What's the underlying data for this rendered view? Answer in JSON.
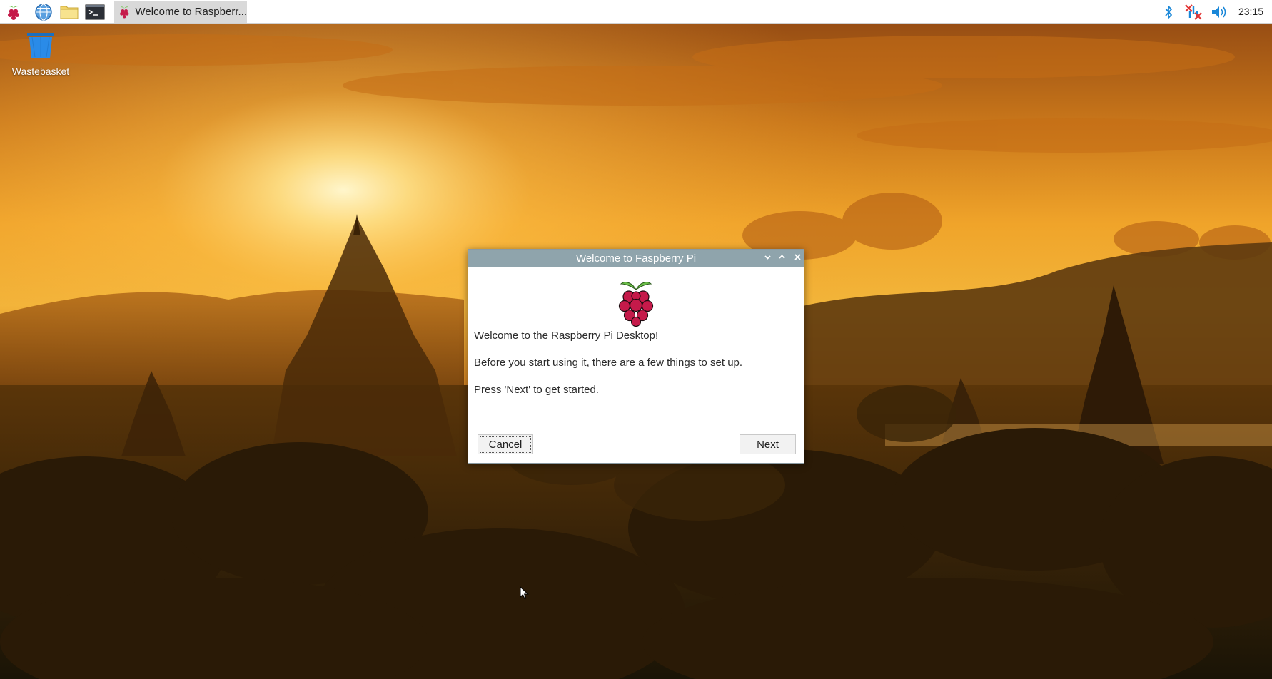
{
  "taskbar": {
    "launchers": [
      "raspberry-menu",
      "web-browser",
      "file-manager",
      "terminal"
    ],
    "active_window_label": "Welcome to Raspberr...",
    "tray_icons": [
      "bluetooth-icon",
      "network-disconnected-icon",
      "volume-icon"
    ],
    "clock": "23:15"
  },
  "desktop": {
    "icons": [
      {
        "label": "Wastebasket",
        "icon": "trash-icon"
      }
    ]
  },
  "dialog": {
    "title": "Welcome to Faspberry Pi",
    "line1": "Welcome to the Raspberry Pi Desktop!",
    "line2": "Before you start using it, there are a few things to set up.",
    "line3": "Press 'Next' to get started.",
    "cancel_label": "Cancel",
    "next_label": "Next",
    "controls": [
      "minimize-icon",
      "maximize-icon",
      "close-icon"
    ]
  },
  "colors": {
    "titlebar": "#8fa4ac",
    "raspberry": "#c51a4a",
    "leaf": "#6cc04a",
    "accent_blue": "#1a87d8",
    "network_red": "#e23333"
  }
}
